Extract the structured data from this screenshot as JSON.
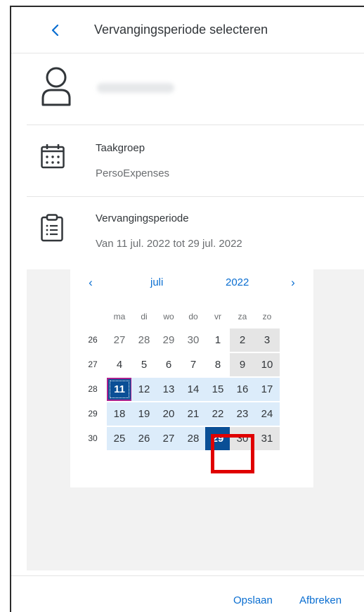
{
  "header": {
    "title": "Vervangingsperiode selecteren"
  },
  "task_group": {
    "label": "Taakgroep",
    "value": "PersoExpenses"
  },
  "period": {
    "label": "Vervangingsperiode",
    "value": "Van 11 jul. 2022 tot 29 jul. 2022"
  },
  "calendar": {
    "month": "juli",
    "year": "2022",
    "weekdays": [
      "ma",
      "di",
      "wo",
      "do",
      "vr",
      "za",
      "zo"
    ],
    "weeks": [
      {
        "num": "26",
        "days": [
          "27",
          "28",
          "29",
          "30",
          "1",
          "2",
          "3"
        ]
      },
      {
        "num": "27",
        "days": [
          "4",
          "5",
          "6",
          "7",
          "8",
          "9",
          "10"
        ]
      },
      {
        "num": "28",
        "days": [
          "11",
          "12",
          "13",
          "14",
          "15",
          "16",
          "17"
        ]
      },
      {
        "num": "29",
        "days": [
          "18",
          "19",
          "20",
          "21",
          "22",
          "23",
          "24"
        ]
      },
      {
        "num": "30",
        "days": [
          "25",
          "26",
          "27",
          "28",
          "29",
          "30",
          "31"
        ]
      }
    ],
    "range_start": "11",
    "range_end": "29"
  },
  "footer": {
    "save_label": "Opslaan",
    "cancel_label": "Afbreken"
  },
  "colors": {
    "accent": "#0a6ed1",
    "selected": "#0a4f96",
    "range": "#dcecfa",
    "highlight": "#e00000"
  }
}
